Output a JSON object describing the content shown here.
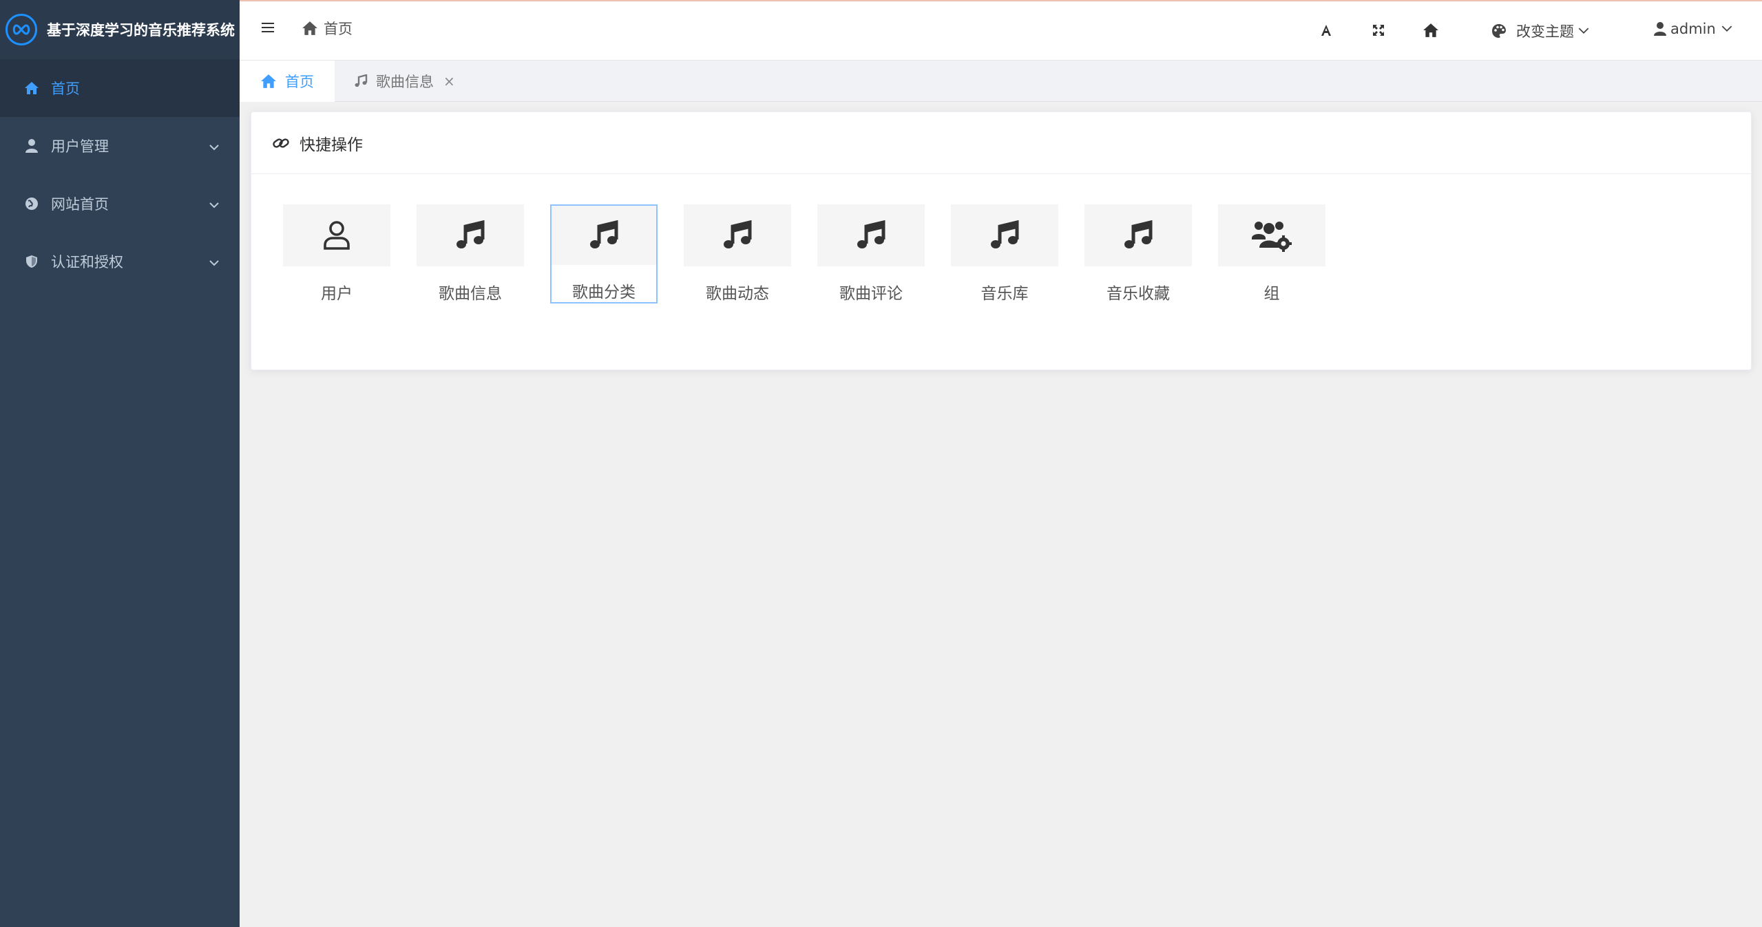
{
  "app": {
    "title": "基于深度学习的音乐推荐系统"
  },
  "sidebar": {
    "items": [
      {
        "label": "首页",
        "icon": "home-icon"
      },
      {
        "label": "用户管理",
        "icon": "user-icon"
      },
      {
        "label": "网站首页",
        "icon": "globe-icon"
      },
      {
        "label": "认证和授权",
        "icon": "shield-icon"
      }
    ]
  },
  "header": {
    "breadcrumb": "首页",
    "theme_label": "改变主题",
    "user_label": "admin"
  },
  "tabs": [
    {
      "label": "首页",
      "icon": "home-icon"
    },
    {
      "label": "歌曲信息",
      "icon": "music-icon",
      "close": "×"
    }
  ],
  "card": {
    "title": "快捷操作",
    "shortcuts": [
      {
        "label": "用户",
        "icon": "user-outline-icon"
      },
      {
        "label": "歌曲信息",
        "icon": "music-icon"
      },
      {
        "label": "歌曲分类",
        "icon": "music-icon",
        "selected": true
      },
      {
        "label": "歌曲动态",
        "icon": "music-icon"
      },
      {
        "label": "歌曲评论",
        "icon": "music-icon"
      },
      {
        "label": "音乐库",
        "icon": "music-icon"
      },
      {
        "label": "音乐收藏",
        "icon": "music-icon"
      },
      {
        "label": "组",
        "icon": "users-cog-icon"
      }
    ]
  },
  "colors": {
    "sidebar_bg": "#304156",
    "accent": "#409eff",
    "menu_text": "#bfcbd9"
  }
}
